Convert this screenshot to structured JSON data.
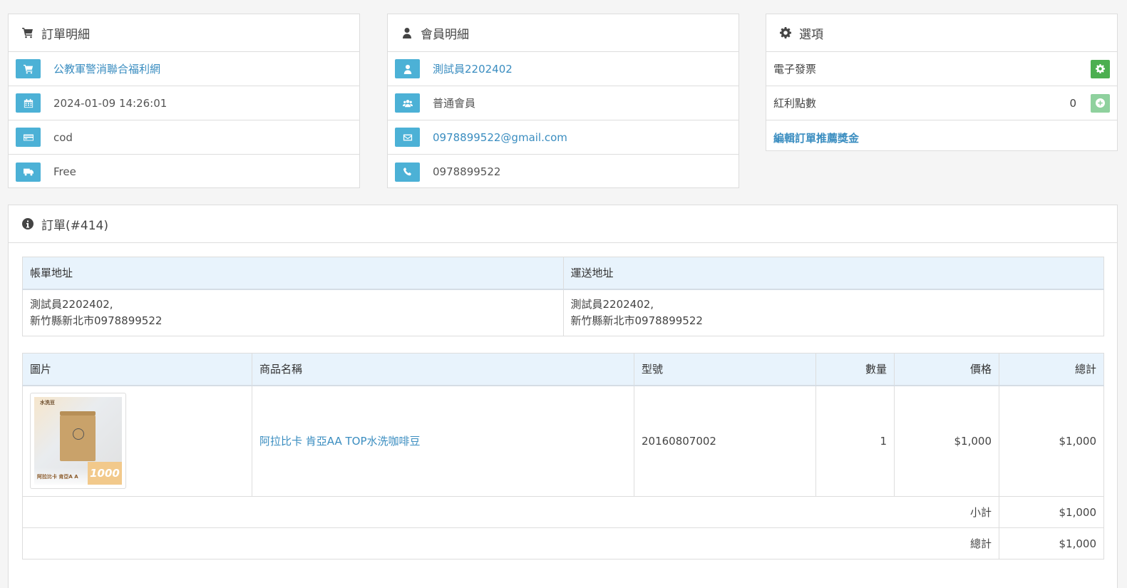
{
  "order_details": {
    "title": "訂單明細",
    "store": "公教軍警消聯合福利網",
    "date": "2024-01-09 14:26:01",
    "payment": "cod",
    "shipping": "Free"
  },
  "customer_details": {
    "title": "會員明細",
    "name": "測試員2202402",
    "group": "普通會員",
    "email": "0978899522@gmail.com",
    "phone": "0978899522"
  },
  "options": {
    "title": "選項",
    "invoice_label": "電子發票",
    "reward_label": "紅利點數",
    "reward_value": "0",
    "commission_link": "編輯訂單推薦獎金"
  },
  "order": {
    "title": "訂單(#414)",
    "address_headers": {
      "payment": "帳單地址",
      "shipping": "運送地址"
    },
    "payment_address": {
      "line1": "測試員2202402,",
      "line2": "新竹縣新北市0978899522"
    },
    "shipping_address": {
      "line1": "測試員2202402,",
      "line2": "新竹縣新北市0978899522"
    },
    "product_headers": {
      "image": "圖片",
      "name": "商品名稱",
      "model": "型號",
      "quantity": "數量",
      "price": "價格",
      "total": "總計"
    },
    "products": [
      {
        "image_top_text": "水洗豆",
        "image_caption": "阿拉比卡 肯亞A A",
        "image_badge": "1000",
        "name": "阿拉比卡 肯亞AA TOP水洗咖啡豆",
        "model": "20160807002",
        "quantity": "1",
        "price": "$1,000",
        "total": "$1,000"
      }
    ],
    "totals": [
      {
        "label": "小計",
        "value": "$1,000"
      },
      {
        "label": "總計",
        "value": "$1,000"
      }
    ]
  },
  "colors": {
    "info_icon_bg": "#4cb1d6",
    "link": "#3a8dc0",
    "green_button": "#4caf50",
    "table_header_bg": "#e8f3fc"
  },
  "icons": {
    "order_details": "shopping-cart-icon",
    "customer_details": "user-icon",
    "options": "gear-icon",
    "order": "info-circle-icon"
  }
}
